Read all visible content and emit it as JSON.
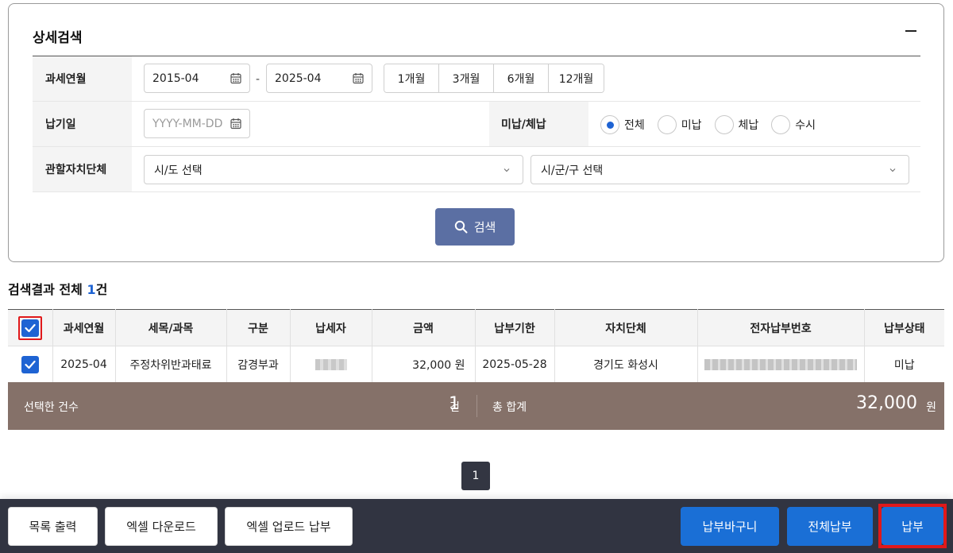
{
  "search": {
    "title": "상세검색",
    "tax_month_label": "과세연월",
    "tax_month_from": "2015-04",
    "tax_month_sep": "-",
    "tax_month_to": "2025-04",
    "periods": [
      "1개월",
      "3개월",
      "6개월",
      "12개월"
    ],
    "due_date_label": "납기일",
    "due_date_placeholder": "YYYY-MM-DD",
    "status_label": "미납/체납",
    "status_options": [
      "전체",
      "미납",
      "체납",
      "수시"
    ],
    "status_selected": "전체",
    "region_label": "관할자치단체",
    "province_value": "시/도 선택",
    "city_value": "시/군/구 선택",
    "search_button": "검색"
  },
  "results": {
    "summary_prefix": "검색결과 전체",
    "summary_count": "1",
    "summary_suffix": "건",
    "columns": [
      "과세연월",
      "세목/과목",
      "구분",
      "납세자",
      "금액",
      "납부기한",
      "자치단체",
      "전자납부번호",
      "납부상태"
    ],
    "rows": [
      {
        "checked": true,
        "tax_month": "2025-04",
        "tax_item": "주정차위반과태료",
        "category": "감경부과",
        "amount": "32,000 원",
        "due_date": "2025-05-28",
        "municipality": "경기도 화성시",
        "status": "미납"
      }
    ]
  },
  "totals": {
    "selected_label": "선택한 건수",
    "selected_count": "1",
    "selected_unit": "건",
    "sum_label": "총 합계",
    "sum_value": "32,000",
    "sum_unit": "원"
  },
  "pagination": {
    "current": "1"
  },
  "bottom_bar": {
    "print_list": "목록 출력",
    "excel_download": "엑셀 다운로드",
    "excel_upload_pay": "엑셀 업로드 납부",
    "pay_basket": "납부바구니",
    "pay_all": "전체납부",
    "pay": "납부"
  },
  "colors": {
    "primary_blue": "#1a6fd6",
    "search_button": "#5b6fa3",
    "total_bar": "#857169",
    "bottom_bar": "#313441",
    "highlight_red": "#e0191b"
  },
  "icons": [
    "calendar-icon",
    "chevron-down-icon",
    "search-icon",
    "check-icon",
    "minus-icon"
  ]
}
